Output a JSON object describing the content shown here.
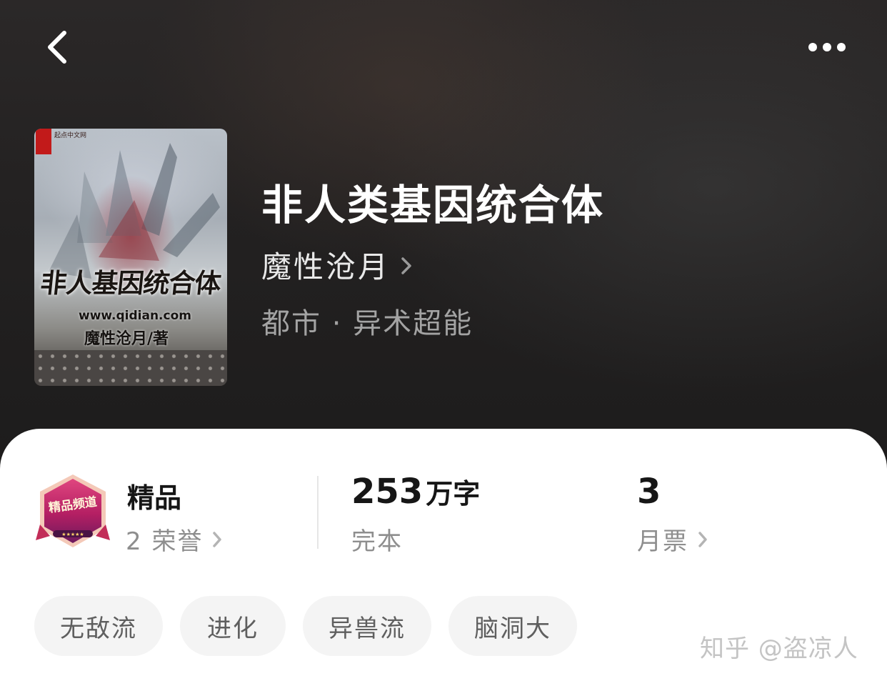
{
  "header": {
    "back_icon": "chevron-left-icon",
    "more_icon": "more-horizontal-icon"
  },
  "book": {
    "cover": {
      "publisher_text": "起点中文网",
      "title_text": "非人基因统合体",
      "url_text": "www.qidian.com",
      "author_text": "魔性沧月/著"
    },
    "title": "非人类基因统合体",
    "author": "魔性沧月",
    "genre": "都市 · 异术超能"
  },
  "stats": {
    "level": {
      "badge_icon": "premium-channel-badge-icon",
      "badge_text": "精品频道",
      "label": "精品",
      "honors": "2 荣誉"
    },
    "words": {
      "number": "253",
      "unit": "万字",
      "status": "完本"
    },
    "tickets": {
      "number": "3",
      "label": "月票"
    }
  },
  "tags": [
    "无敌流",
    "进化",
    "异兽流",
    "脑洞大"
  ],
  "watermark": "知乎 @盗凉人",
  "colors": {
    "header_bg": "#232121",
    "title": "#ffffff",
    "muted": "#8e8e8e",
    "tag_bg": "#f4f4f4",
    "badge_magenta": "#b8226a"
  }
}
